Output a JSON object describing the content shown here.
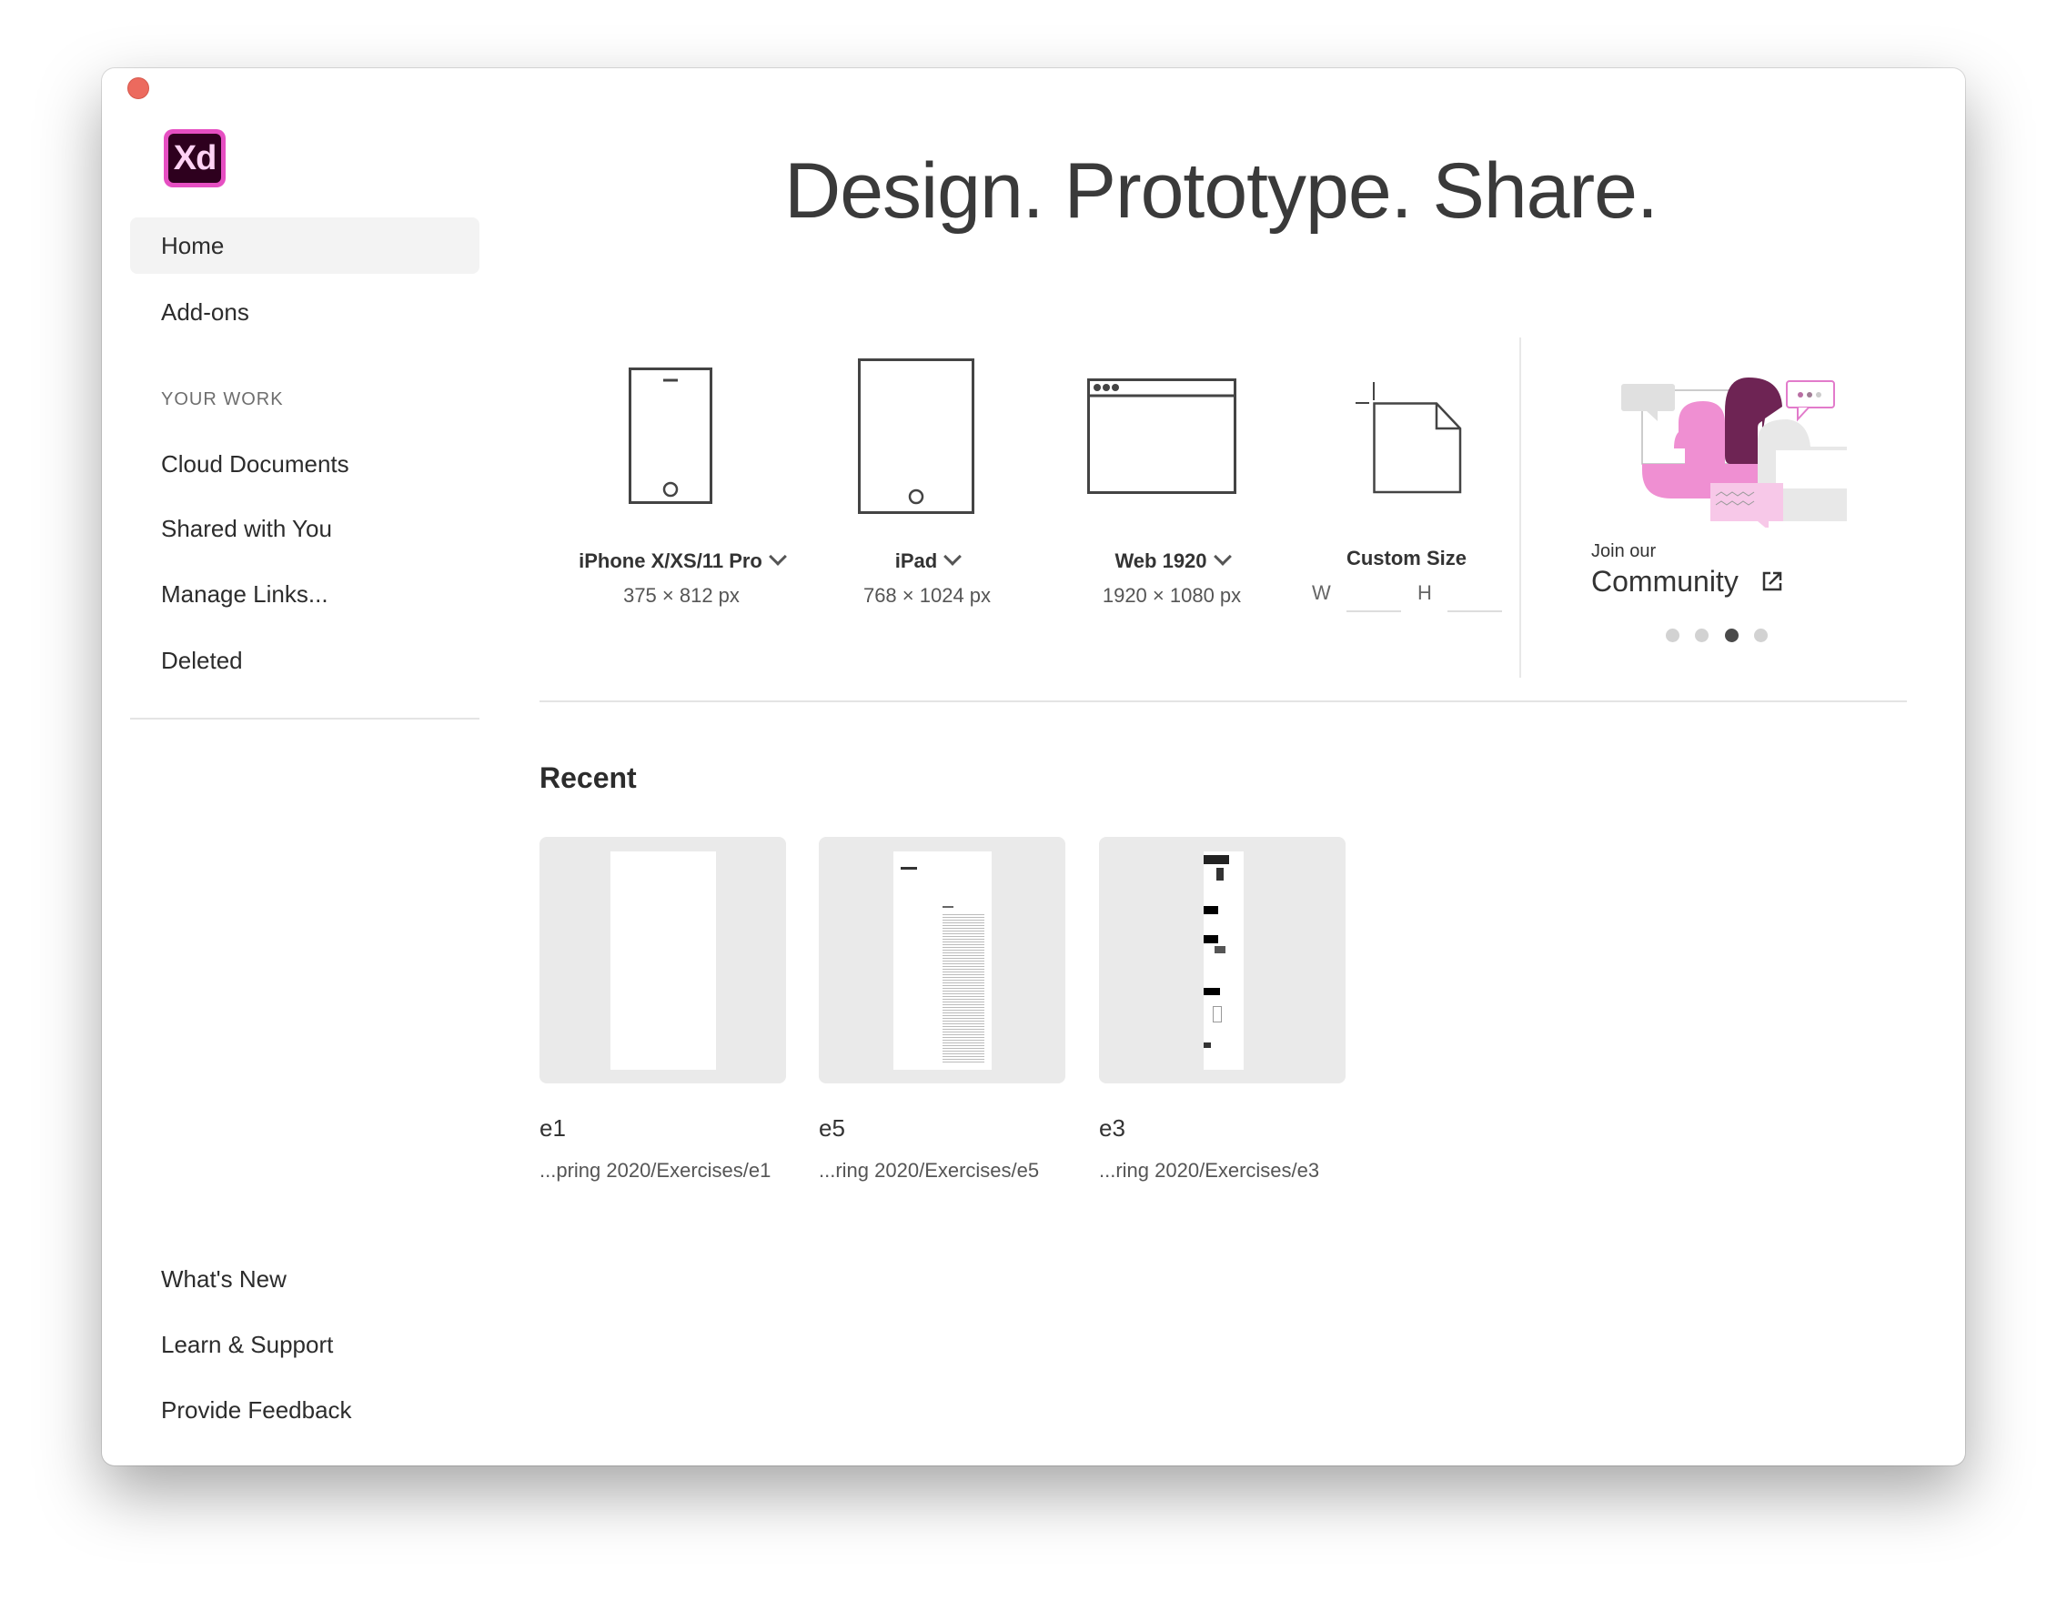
{
  "window": {
    "close_color": "#ec6a5e"
  },
  "logo": {
    "text": "Xd",
    "brand_color": "#e64fc2"
  },
  "sidebar": {
    "items": [
      {
        "label": "Home",
        "active": true
      },
      {
        "label": "Add-ons"
      }
    ],
    "section_title": "YOUR WORK",
    "work_items": [
      {
        "label": "Cloud Documents"
      },
      {
        "label": "Shared with You"
      },
      {
        "label": "Manage Links..."
      },
      {
        "label": "Deleted"
      }
    ],
    "footer_items": [
      {
        "label": "What's New"
      },
      {
        "label": "Learn & Support"
      },
      {
        "label": "Provide Feedback"
      }
    ]
  },
  "hero": {
    "title": "Design. Prototype. Share."
  },
  "presets": [
    {
      "label": "iPhone X/XS/11 Pro",
      "size": "375 × 812 px",
      "icon": "phone-icon"
    },
    {
      "label": "iPad",
      "size": "768 × 1024 px",
      "icon": "tablet-icon"
    },
    {
      "label": "Web 1920",
      "size": "1920 × 1080 px",
      "icon": "browser-icon"
    }
  ],
  "custom_size": {
    "label": "Custom Size",
    "w_label": "W",
    "h_label": "H",
    "w_value": "",
    "h_value": ""
  },
  "promo": {
    "pre": "Join our",
    "title": "Community",
    "carousel_active_index": 2,
    "carousel_count": 4
  },
  "recent": {
    "title": "Recent",
    "files": [
      {
        "name": "e1",
        "path": "...pring 2020/Exercises/e1"
      },
      {
        "name": "e5",
        "path": "...ring 2020/Exercises/e5"
      },
      {
        "name": "e3",
        "path": "...ring 2020/Exercises/e3"
      }
    ]
  }
}
